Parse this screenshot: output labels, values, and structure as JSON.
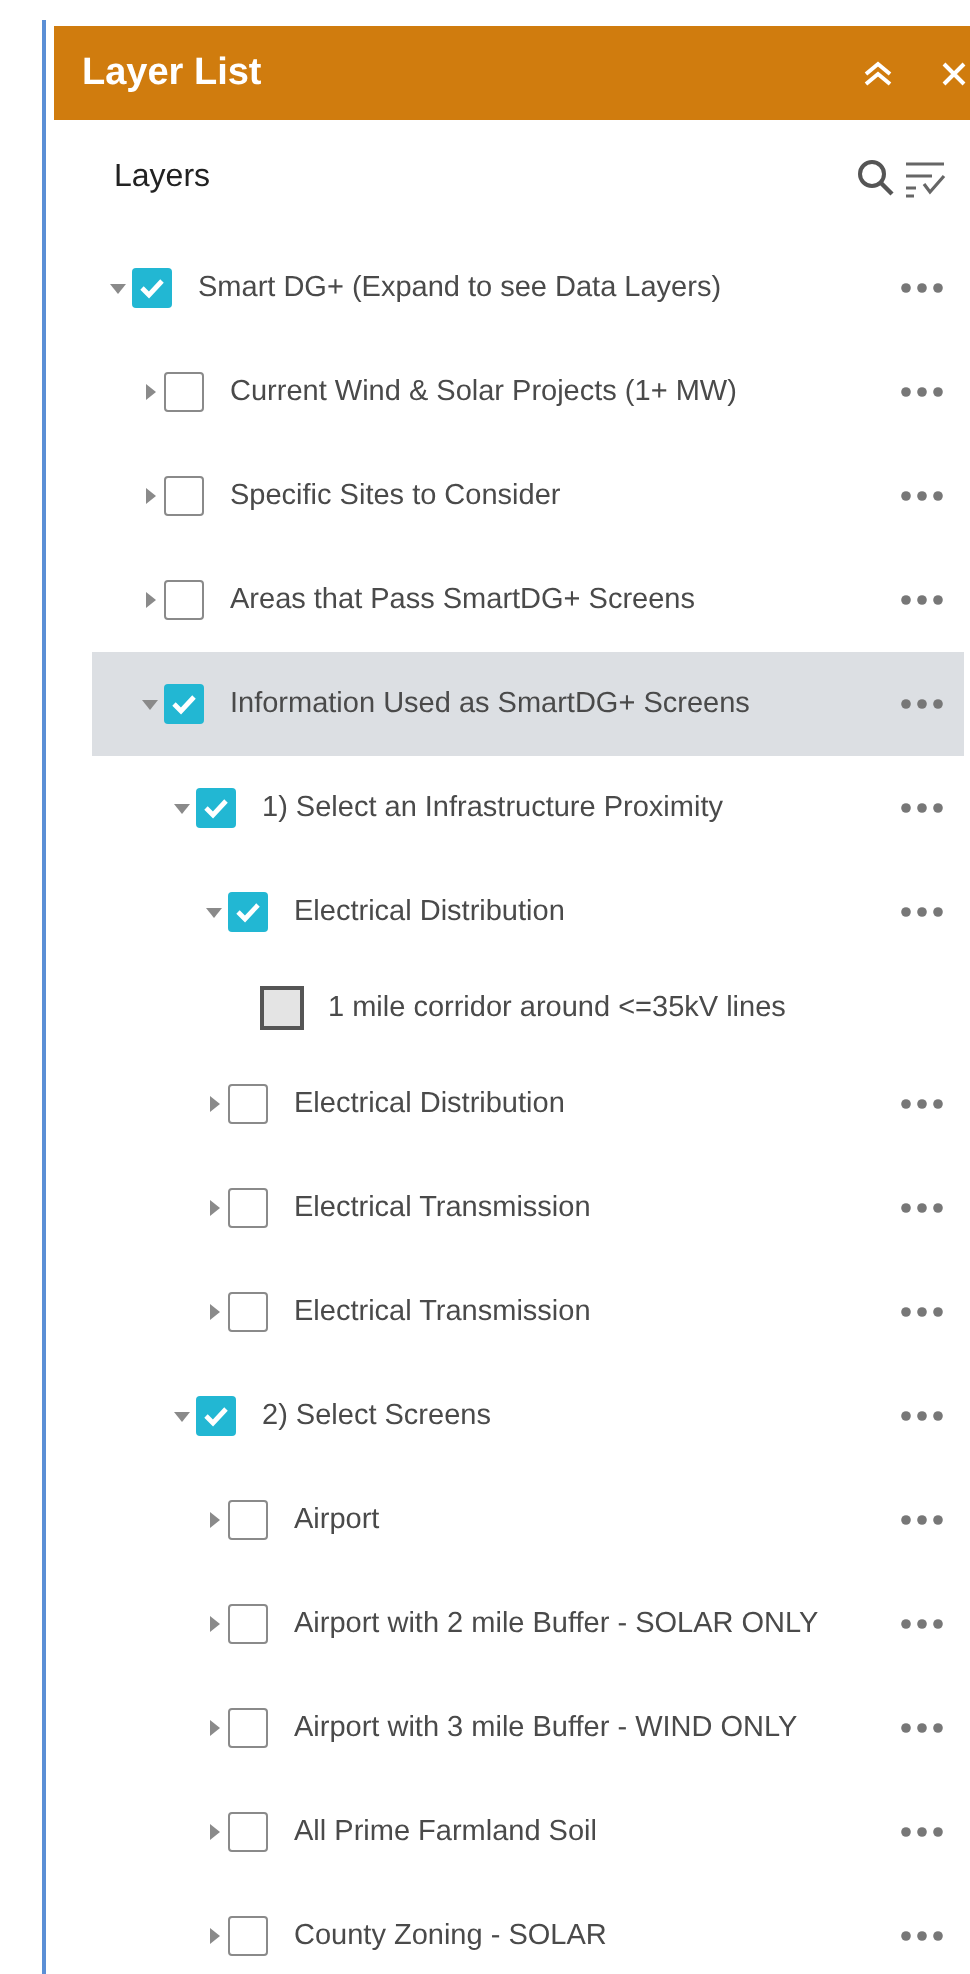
{
  "panel": {
    "title": "Layer List"
  },
  "toolbar": {
    "heading": "Layers"
  },
  "layers": [
    {
      "kind": "layer",
      "label": "Smart DG+ (Expand to see Data Layers)",
      "checked": true,
      "expanded": true,
      "selected": false,
      "children": [
        {
          "kind": "layer",
          "label": "Current Wind & Solar Projects (1+ MW)",
          "checked": false,
          "expanded": false,
          "selected": false
        },
        {
          "kind": "layer",
          "label": "Specific Sites to Consider",
          "checked": false,
          "expanded": false,
          "selected": false
        },
        {
          "kind": "layer",
          "label": "Areas that Pass SmartDG+ Screens",
          "checked": false,
          "expanded": false,
          "selected": false
        },
        {
          "kind": "layer",
          "label": "Information Used as SmartDG+ Screens",
          "checked": true,
          "expanded": true,
          "selected": true,
          "children": [
            {
              "kind": "layer",
              "label": "1) Select an Infrastructure Proximity",
              "checked": true,
              "expanded": true,
              "selected": false,
              "children": [
                {
                  "kind": "layer",
                  "label": "Electrical Distribution",
                  "checked": true,
                  "expanded": true,
                  "selected": false,
                  "children": [
                    {
                      "kind": "legend",
                      "label": "1 mile corridor around <=35kV lines"
                    }
                  ]
                },
                {
                  "kind": "layer",
                  "label": "Electrical Distribution",
                  "checked": false,
                  "expanded": false,
                  "selected": false
                },
                {
                  "kind": "layer",
                  "label": "Electrical Transmission",
                  "checked": false,
                  "expanded": false,
                  "selected": false
                },
                {
                  "kind": "layer",
                  "label": "Electrical Transmission",
                  "checked": false,
                  "expanded": false,
                  "selected": false
                }
              ]
            },
            {
              "kind": "layer",
              "label": "2) Select Screens",
              "checked": true,
              "expanded": true,
              "selected": false,
              "children": [
                {
                  "kind": "layer",
                  "label": "Airport",
                  "checked": false,
                  "expanded": false,
                  "selected": false
                },
                {
                  "kind": "layer",
                  "label": "Airport with 2 mile Buffer - SOLAR ONLY",
                  "checked": false,
                  "expanded": false,
                  "selected": false
                },
                {
                  "kind": "layer",
                  "label": "Airport with 3 mile Buffer - WIND ONLY",
                  "checked": false,
                  "expanded": false,
                  "selected": false
                },
                {
                  "kind": "layer",
                  "label": "All Prime Farmland Soil",
                  "checked": false,
                  "expanded": false,
                  "selected": false
                },
                {
                  "kind": "layer",
                  "label": "County Zoning - SOLAR",
                  "checked": false,
                  "expanded": false,
                  "selected": false
                }
              ]
            }
          ]
        }
      ]
    }
  ]
}
